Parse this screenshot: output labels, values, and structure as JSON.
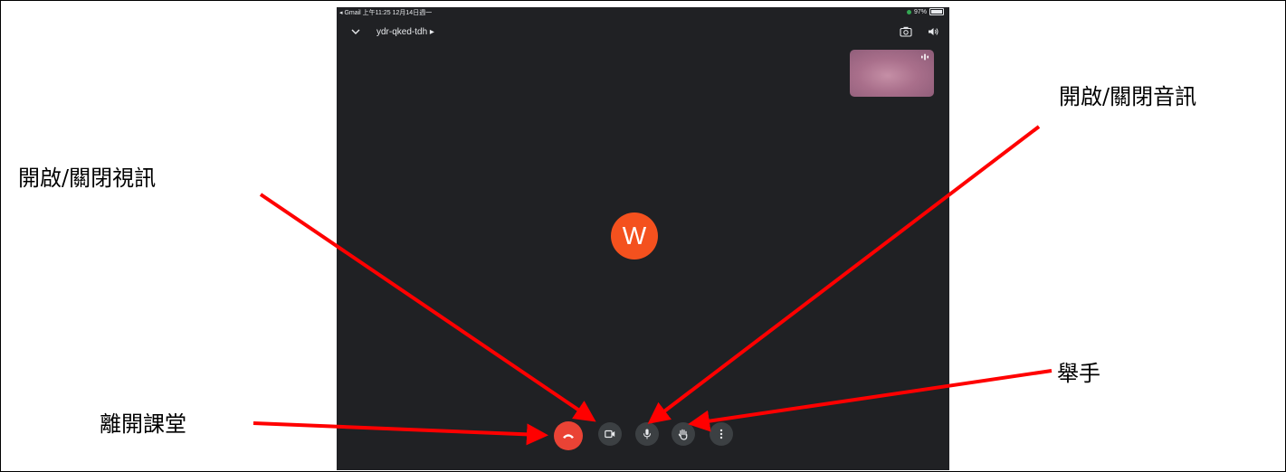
{
  "status_bar": {
    "left_text": "◂ Gmail  上午11:25  12月14日週一",
    "battery_text": "97%",
    "battery_level": 0.97
  },
  "meeting": {
    "code": "ydr-qked-tdh ▸",
    "avatar_initial": "W"
  },
  "icons": {
    "collapse": "chevron-down-icon",
    "switch_camera": "switch-camera-icon",
    "audio_output": "speaker-icon",
    "end_call": "hang-up-icon",
    "camera": "video-camera-icon",
    "microphone": "microphone-icon",
    "raise_hand": "hand-icon",
    "more": "more-vert-icon"
  },
  "annotations": {
    "video_toggle": "開啟/關閉視訊",
    "audio_toggle": "開啟/關閉音訊",
    "leave_class": "離開課堂",
    "raise_hand": "舉手"
  },
  "colors": {
    "background": "#202124",
    "end_call": "#ea4335",
    "avatar": "#f4511e",
    "control": "#3c4043",
    "arrow": "#ff0000"
  }
}
